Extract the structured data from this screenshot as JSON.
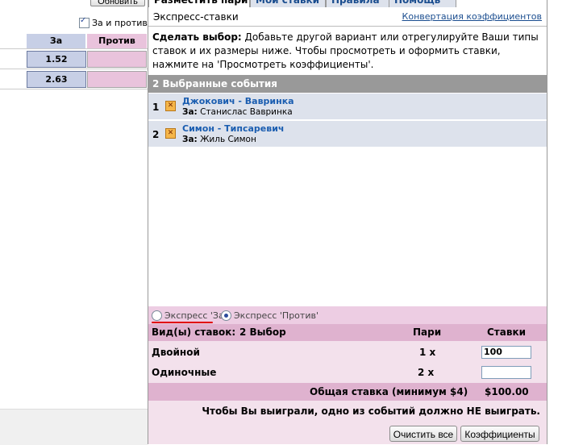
{
  "left": {
    "refresh_label": "Обновить",
    "for_against_label": "За и против",
    "col_for": "За",
    "col_against": "Против",
    "rows": [
      {
        "for": "1.52",
        "against": ""
      },
      {
        "for": "2.63",
        "against": ""
      }
    ]
  },
  "tabs": [
    {
      "label": "Разместить пари"
    },
    {
      "label": "Мои ставки"
    },
    {
      "label": "Правила"
    },
    {
      "label": "Помощь"
    }
  ],
  "header": {
    "title": "Экспресс-ставки",
    "link": "Конвертация коэффициентов"
  },
  "instructions": {
    "bold": "Сделать выбор:",
    "text": " Добавьте другой вариант или отрегулируйте Ваши типы ставок и их размеры ниже. Чтобы просмотреть и оформить ставки, нажмите на 'Просмотреть коэффициенты'."
  },
  "selected_header": "2 Выбранные события",
  "events": [
    {
      "num": "1",
      "title": "Джокович - Вавринка",
      "pick_label": "За:",
      "pick": "Станислас Вавринка"
    },
    {
      "num": "2",
      "title": "Симон - Типсаревич",
      "pick_label": "За:",
      "pick": "Жиль Симон"
    }
  ],
  "express": {
    "option_for": "Экспресс 'За'",
    "option_against": "Экспресс 'Против'",
    "selected": "against"
  },
  "bet": {
    "type_label": "Вид(ы) ставок:",
    "type_count": "2 Выбор",
    "col_bets": "Пари",
    "col_stakes": "Ставки",
    "rows": [
      {
        "name": "Двойной",
        "count": "1 x",
        "stake": "100"
      },
      {
        "name": "Одиночные",
        "count": "2 x",
        "stake": ""
      }
    ],
    "total_label": "Общая ставка (минимум $4)",
    "total_value": "$100.00",
    "note": "Чтобы Вы выиграли, одно из событий должно НЕ выиграть.",
    "clear_button": "Очистить все",
    "odds_button": "Коэффициенты"
  },
  "colors": {
    "for_bg": "#c7cfe6",
    "against_bg": "#e9c3dc",
    "link": "#1a5db0",
    "annotation_red": "#e00000"
  }
}
